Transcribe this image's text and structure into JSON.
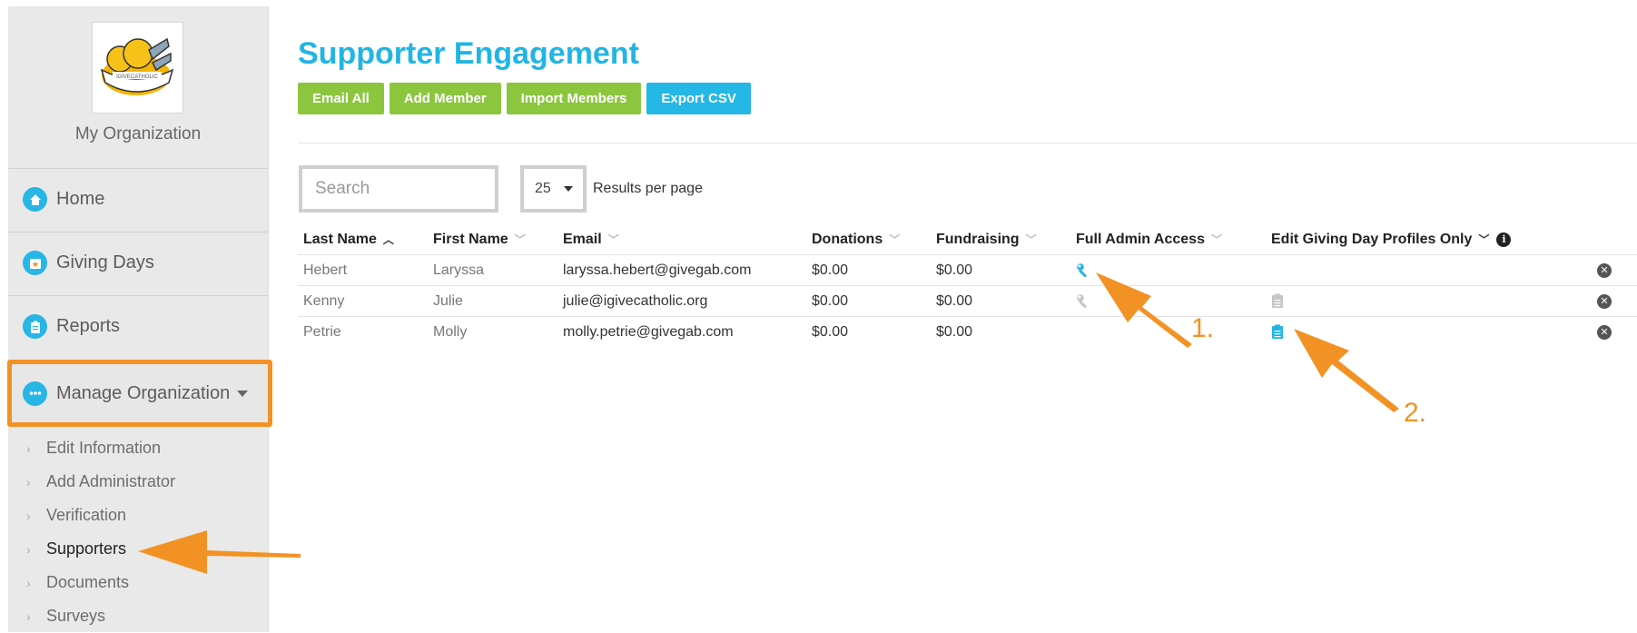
{
  "sidebar": {
    "org_name": "My Organization",
    "logo_text": "iGIVECATHOLIC",
    "nav": [
      {
        "label": "Home",
        "icon": "home-icon"
      },
      {
        "label": "Giving Days",
        "icon": "calendar-star-icon"
      },
      {
        "label": "Reports",
        "icon": "clipboard-icon"
      },
      {
        "label": "Manage Organization",
        "icon": "ellipsis-icon"
      }
    ],
    "subnav": [
      "Edit Information",
      "Add Administrator",
      "Verification",
      "Supporters",
      "Documents",
      "Surveys"
    ]
  },
  "main": {
    "title": "Supporter Engagement",
    "buttons": {
      "email_all": "Email All",
      "add_member": "Add Member",
      "import_members": "Import Members",
      "export_csv": "Export CSV"
    },
    "search_placeholder": "Search",
    "per_page_value": "25",
    "per_page_label": "Results per page",
    "table": {
      "headers": {
        "last_name": "Last Name",
        "first_name": "First Name",
        "email": "Email",
        "donations": "Donations",
        "fundraising": "Fundraising",
        "full_admin": "Full Admin Access",
        "edit_profiles": "Edit Giving Day Profiles Only"
      },
      "rows": [
        {
          "last": "Hebert",
          "first": "Laryssa",
          "email": "laryssa.hebert@givegab.com",
          "donations": "$0.00",
          "fundraising": "$0.00",
          "full_admin": "active",
          "edit_profiles": "none"
        },
        {
          "last": "Kenny",
          "first": "Julie",
          "email": "julie@igivecatholic.org",
          "donations": "$0.00",
          "fundraising": "$0.00",
          "full_admin": "inactive",
          "edit_profiles": "inactive"
        },
        {
          "last": "Petrie",
          "first": "Molly",
          "email": "molly.petrie@givegab.com",
          "donations": "$0.00",
          "fundraising": "$0.00",
          "full_admin": "none",
          "edit_profiles": "active"
        }
      ]
    }
  },
  "annotations": {
    "label_1": "1.",
    "label_2": "2."
  },
  "colors": {
    "accent": "#22b5e4",
    "green": "#8cc63f",
    "annotation": "#f39224"
  }
}
